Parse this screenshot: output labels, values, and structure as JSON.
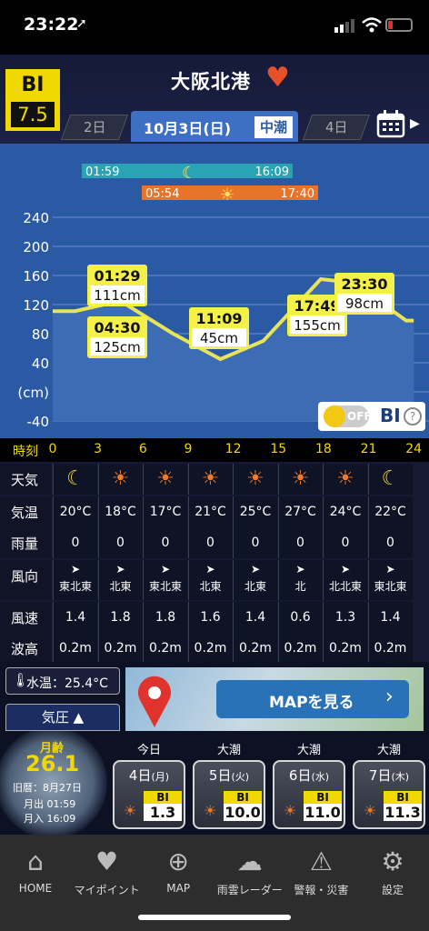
{
  "status": {
    "time": "23:22"
  },
  "bi": {
    "label": "BI",
    "value": "7.5"
  },
  "title": "大阪北港",
  "datenav": {
    "prev": "2日",
    "current": "10月3日(日)",
    "tide_type": "中潮",
    "next": "4日"
  },
  "moon_bar": {
    "rise": "01:59",
    "set": "16:09"
  },
  "sun_bar": {
    "rise": "05:54",
    "set": "17:40"
  },
  "chart_data": {
    "type": "line",
    "y_ticks": [
      "240",
      "200",
      "160",
      "120",
      "80",
      "40",
      "(cm)",
      "-40"
    ],
    "x_label": "時刻",
    "x_ticks": [
      "0",
      "3",
      "6",
      "9",
      "12",
      "15",
      "18",
      "21",
      "24"
    ],
    "ylim": [
      -40,
      240
    ],
    "x": [
      0,
      1.48,
      4.5,
      8,
      11.15,
      14,
      17.82,
      20,
      23.5,
      24
    ],
    "y": [
      111,
      111,
      125,
      80,
      45,
      70,
      155,
      150,
      98,
      98
    ],
    "annotations": [
      {
        "time": "01:29",
        "value": "111cm"
      },
      {
        "time": "04:30",
        "value": "125cm"
      },
      {
        "time": "11:09",
        "value": "45cm"
      },
      {
        "time": "17:49",
        "value": "155cm"
      },
      {
        "time": "23:30",
        "value": "98cm"
      }
    ]
  },
  "bi_toggle": {
    "state": "OFF",
    "label": "BI",
    "help": "?"
  },
  "rows": {
    "weather": "天気",
    "temp": "気温",
    "rain": "雨量",
    "wdir": "風向",
    "wspd": "風速",
    "wave": "波高"
  },
  "cols": [
    {
      "icon": "moon",
      "temp": "20°C",
      "rain": "0",
      "dir": "東北東",
      "spd": "1.4",
      "wave": "0.2m"
    },
    {
      "icon": "sun",
      "temp": "18°C",
      "rain": "0",
      "dir": "北東",
      "spd": "1.8",
      "wave": "0.2m"
    },
    {
      "icon": "sun",
      "temp": "17°C",
      "rain": "0",
      "dir": "東北東",
      "spd": "1.8",
      "wave": "0.2m"
    },
    {
      "icon": "sun",
      "temp": "21°C",
      "rain": "0",
      "dir": "北東",
      "spd": "1.6",
      "wave": "0.2m"
    },
    {
      "icon": "sun",
      "temp": "25°C",
      "rain": "0",
      "dir": "北東",
      "spd": "1.4",
      "wave": "0.2m"
    },
    {
      "icon": "sun",
      "temp": "27°C",
      "rain": "0",
      "dir": "北",
      "spd": "0.6",
      "wave": "0.2m"
    },
    {
      "icon": "sun",
      "temp": "24°C",
      "rain": "0",
      "dir": "北北東",
      "spd": "1.3",
      "wave": "0.2m"
    },
    {
      "icon": "moon",
      "temp": "22°C",
      "rain": "0",
      "dir": "東北東",
      "spd": "1.4",
      "wave": "0.2m"
    }
  ],
  "water_temp": "水温：25.4°C",
  "pressure": "気圧",
  "map_button": "MAPを見る",
  "moon_age": {
    "label": "月齢",
    "value": "26.1",
    "old_cal": "旧暦：8月27日",
    "rise": "月出 01:59",
    "set": "月入 16:09"
  },
  "days": [
    {
      "head": "今日",
      "date": "4日",
      "dow": "(月)",
      "bi": "1.3"
    },
    {
      "head": "大潮",
      "date": "5日",
      "dow": "(火)",
      "bi": "10.0"
    },
    {
      "head": "大潮",
      "date": "6日",
      "dow": "(水)",
      "bi": "11.0"
    },
    {
      "head": "大潮",
      "date": "7日",
      "dow": "(木)",
      "bi": "11.3"
    }
  ],
  "tabs": [
    "HOME",
    "マイポイント",
    "MAP",
    "雨雲レーダー",
    "警報・災害",
    "設定"
  ]
}
